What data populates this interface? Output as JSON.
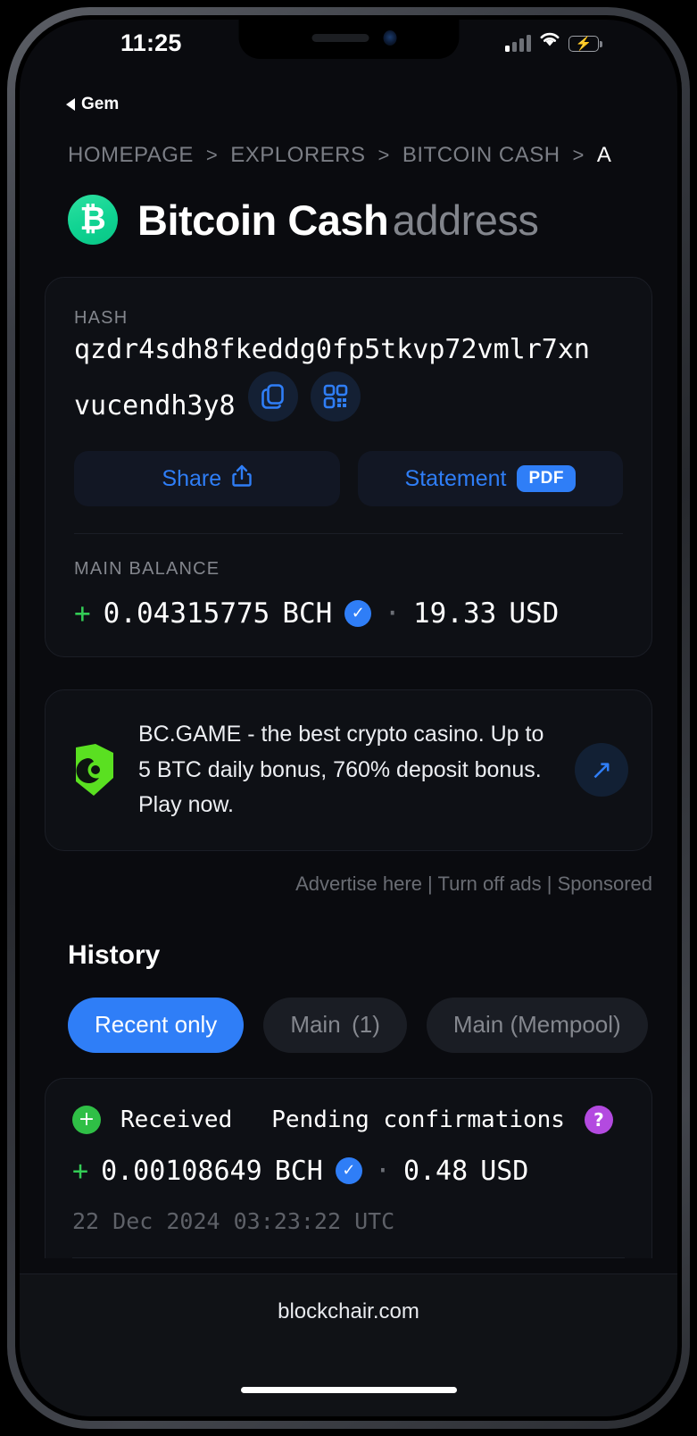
{
  "status_bar": {
    "time": "11:25",
    "back_app_label": "Gem",
    "icons": {
      "signal": "cellular-signal-icon",
      "wifi": "wifi-icon",
      "battery": "battery-charging-icon"
    }
  },
  "breadcrumb": {
    "items": [
      "HOMEPAGE",
      "EXPLORERS",
      "BITCOIN CASH",
      "A"
    ],
    "separator": ">"
  },
  "header": {
    "coin_symbol": "₿",
    "title_strong": "Bitcoin Cash",
    "title_muted": "address",
    "coin_color": "#0fd392"
  },
  "hash_card": {
    "label": "HASH",
    "value_line1": "qzdr4sdh8fkeddg0fp5tkvp72vmlr7xn",
    "value_line2": "vucendh3y8",
    "copy_icon": "copy-icon",
    "qr_icon": "qr-code-icon",
    "share_label": "Share",
    "share_icon": "share-icon",
    "statement_label": "Statement",
    "statement_badge": "PDF"
  },
  "balance": {
    "label": "MAIN BALANCE",
    "sign": "+",
    "amount": "0.04315775",
    "currency": "BCH",
    "separator": "·",
    "fiat_amount": "19.33",
    "fiat_currency": "USD",
    "verified_icon": "verified-check-icon"
  },
  "ad": {
    "logo_icon": "bcgame-logo-icon",
    "text": "BC.GAME - the best crypto casino. Up to 5 BTC daily bonus, 760% deposit bonus. Play now.",
    "arrow_icon": "external-link-arrow-icon",
    "links": "Advertise here | Turn off ads | Sponsored"
  },
  "history": {
    "title": "History",
    "tabs": [
      {
        "label": "Recent only",
        "active": true
      },
      {
        "label": "Main  (1)",
        "active": false
      },
      {
        "label": "Main (Mempool)",
        "active": false
      }
    ],
    "transactions": [
      {
        "direction": "Received",
        "status": "Pending confirmations",
        "help_badge": "?",
        "sign": "+",
        "amount": "0.00108649",
        "currency": "BCH",
        "separator": "·",
        "fiat_amount": "0.48",
        "fiat_currency": "USD",
        "timestamp": "22 Dec 2024 03:23:22 UTC"
      }
    ]
  },
  "browser": {
    "url": "blockchair.com"
  },
  "colors": {
    "accent_blue": "#2f7ef7",
    "green": "#33cc55",
    "purple": "#b34ae0",
    "page_bg": "#0a0b0f",
    "card_bg": "#0e1015"
  }
}
